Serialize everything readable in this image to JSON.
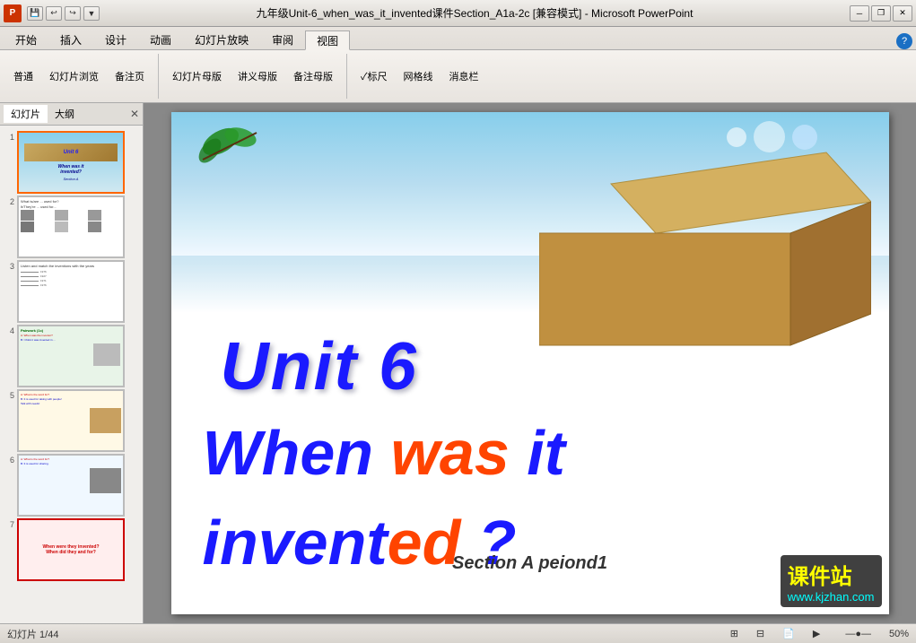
{
  "window": {
    "title": "九年级Unit-6_when_was_it_invented课件Section_A1a-2c [兼容模式] - Microsoft PowerPoint",
    "title_blue_part": "Microsoft PowerPoint"
  },
  "ribbon": {
    "tabs": [
      "开始",
      "插入",
      "设计",
      "动画",
      "幻灯片放映",
      "审阅",
      "视图"
    ],
    "active_tab": "开始"
  },
  "sidebar": {
    "tabs": [
      "幻灯片",
      "大纲"
    ],
    "active_tab": "幻灯片",
    "slides": [
      {
        "num": "1",
        "active": true
      },
      {
        "num": "2",
        "active": false
      },
      {
        "num": "3",
        "active": false
      },
      {
        "num": "4",
        "active": false
      },
      {
        "num": "5",
        "active": false
      },
      {
        "num": "6",
        "active": false
      },
      {
        "num": "7",
        "active": false
      }
    ]
  },
  "slide1": {
    "unit_label": "Unit 6",
    "title_when": "When ",
    "title_was": "was",
    "title_it": " it",
    "title_invented_main": "invent",
    "title_invented_ed": "ed",
    "title_question": " ?",
    "section": "Section  A peiond1",
    "box_label": "Unit 6"
  },
  "watermark": {
    "line1": "课件站",
    "line2": "www.kjzhan.com"
  },
  "status": {
    "slide_info": "幻灯片 1/44",
    "theme": "",
    "view_icons": [
      "normal",
      "slide-sorter",
      "reading",
      "slideshow"
    ]
  },
  "quick_access": {
    "save": "💾",
    "undo": "↩",
    "redo": "↪"
  }
}
